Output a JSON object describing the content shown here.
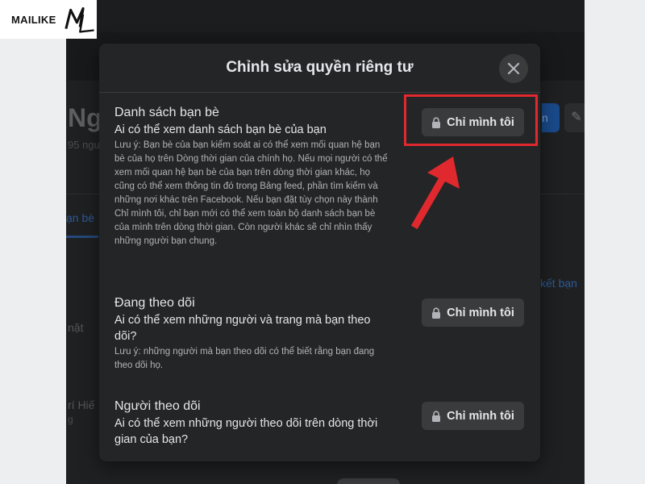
{
  "logo": {
    "text": "MAILIKE",
    "mark": "ML"
  },
  "background_page": {
    "name_partial": "Ngu",
    "friends_partial": "95 ngu",
    "tab_partial": "ạn bè",
    "right_link_partial": "kết bạn",
    "left_text_a": "nặt",
    "left_text_b": "rí Hiế",
    "left_text_c": "g",
    "blue_button_partial": "n"
  },
  "modal": {
    "title": "Chỉnh sửa quyền riêng tư",
    "close_icon": "close-icon",
    "sections": [
      {
        "title": "Danh sách bạn bè",
        "question": "Ai có thể xem danh sách bạn bè của bạn",
        "note": "Lưu ý: Bạn bè của bạn kiểm soát ai có thể xem mối quan hệ bạn bè của họ trên Dòng thời gian của chính họ. Nếu mọi người có thể xem mối quan hệ bạn bè của bạn trên dòng thời gian khác, họ cũng có thể xem thông tin đó trong Bảng feed, phần tìm kiếm và những nơi khác trên Facebook. Nếu bạn đặt tùy chọn này thành Chỉ mình tôi, chỉ bạn mới có thể xem toàn bộ danh sách bạn bè của mình trên dòng thời gian. Còn người khác sẽ chỉ nhìn thấy những người bạn chung.",
        "button_label": "Chỉ mình tôi",
        "button_icon": "lock-icon"
      },
      {
        "title": "Đang theo dõi",
        "question": "Ai có thể xem những người và trang mà bạn theo dõi?",
        "note": "Lưu ý: những người mà bạn theo dõi có thể biết rằng bạn đang theo dõi họ.",
        "button_label": "Chỉ mình tôi",
        "button_icon": "lock-icon"
      },
      {
        "title": "Người theo dõi",
        "question": "Ai có thể xem những người theo dõi trên dòng thời gian của bạn?",
        "note": "",
        "button_label": "Chỉ mình tôi",
        "button_icon": "lock-icon"
      }
    ]
  },
  "annotation": {
    "highlight_color": "#e0292e",
    "arrow_icon": "arrow-up-right-icon"
  }
}
